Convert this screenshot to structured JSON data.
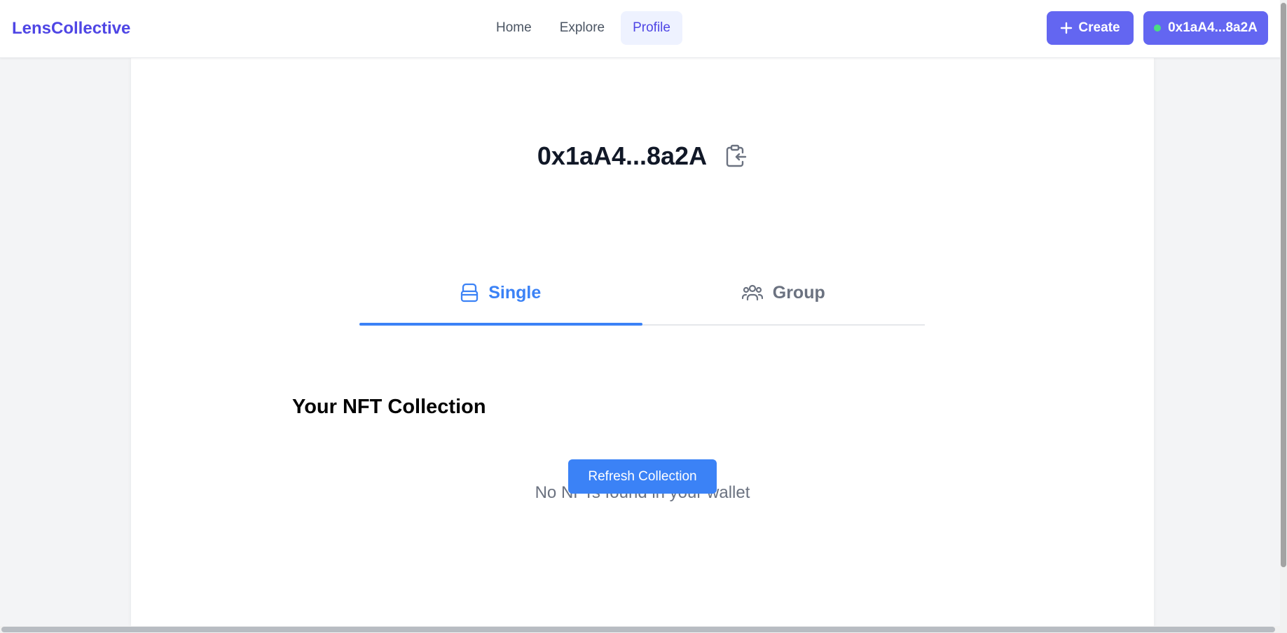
{
  "header": {
    "brand": "LensCollective",
    "nav": [
      {
        "label": "Home",
        "active": false
      },
      {
        "label": "Explore",
        "active": false
      },
      {
        "label": "Profile",
        "active": true
      }
    ],
    "create_label": "Create",
    "wallet_label": "0x1aA4...8a2A",
    "colors": {
      "brand": "#4f46e5",
      "button": "#6366f1",
      "status_dot": "#4ade80"
    }
  },
  "profile": {
    "address": "0x1aA4...8a2A",
    "copy_icon": "clipboard-copy-icon"
  },
  "tabs": [
    {
      "label": "Single",
      "icon": "wallet-icon",
      "active": true
    },
    {
      "label": "Group",
      "icon": "users-icon",
      "active": false
    }
  ],
  "collection": {
    "title": "Your NFT Collection",
    "empty_message": "No NFTs found in your wallet",
    "refresh_label": "Refresh Collection",
    "accent": "#3b82f6"
  }
}
